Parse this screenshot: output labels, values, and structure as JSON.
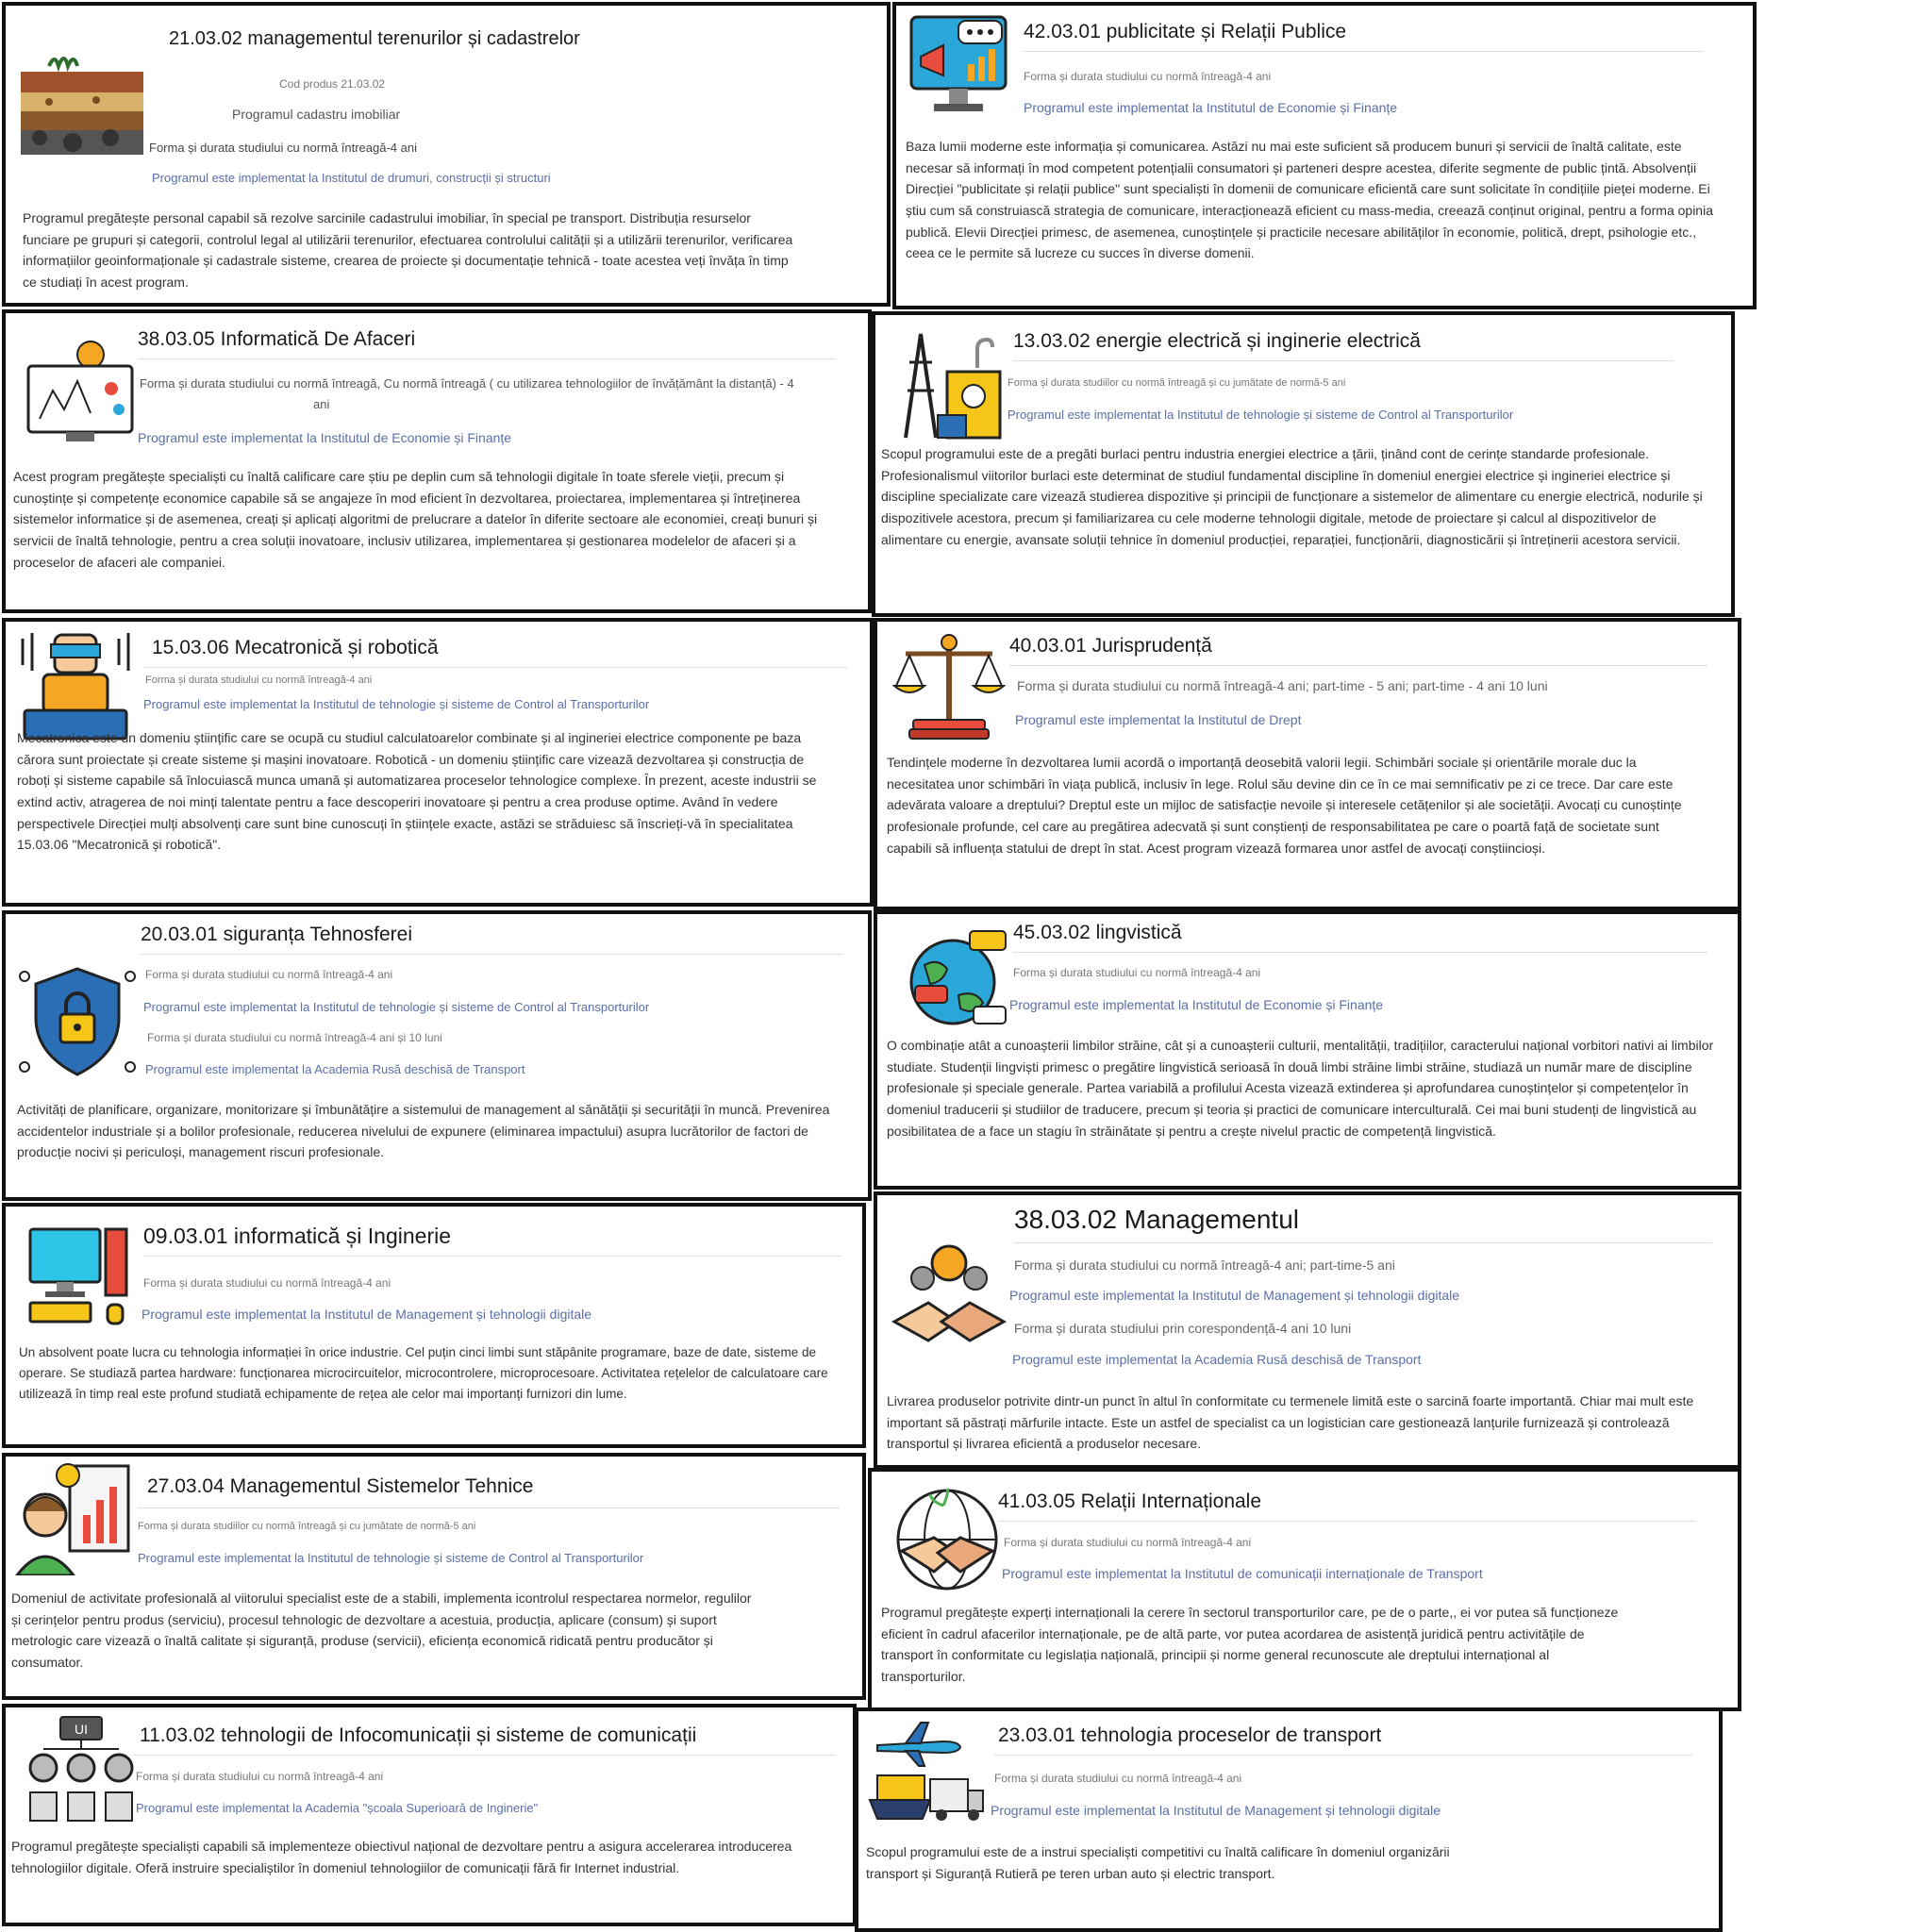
{
  "programs": [
    {
      "title": "21.03.02 managementul terenurilor și cadastrelor",
      "icon": "soil-layers-icon",
      "code": "Cod produs 21.03.02",
      "subtitle": "Programul cadastru imobiliar",
      "forma1": "Forma și durata studiului cu normă întreagă-4 ani",
      "impl1": "Programul este implementat la Institutul de drumuri, construcții și structuri",
      "desc": "Programul pregătește personal capabil să rezolve sarcinile cadastrului imobiliar, în special pe transport. Distribuția resurselor funciare pe grupuri și categorii, controlul legal al utilizării terenurilor, efectuarea controlului calității și a utilizării terenurilor, verificarea informațiilor geoinformaționale și cadastrale sisteme, crearea de proiecte și documentație tehnică - toate acestea veți învăța în timp ce studiați în acest program."
    },
    {
      "title": "42.03.01 publicitate și Relații Publice",
      "icon": "megaphone-monitor-icon",
      "forma1": "Forma și durata studiului cu normă întreagă-4 ani",
      "impl1": "Programul este implementat la Institutul de Economie și Finanțe",
      "desc": "Baza lumii moderne este informația și comunicarea. Astăzi nu mai este suficient să producem bunuri și servicii de înaltă calitate, este necesar să informați în mod competent potențialii consumatori și parteneri despre acestea, diferite segmente de public țintă. Absolvenții Direcției \"publicitate și relații publice\" sunt specialiști în domenii de comunicare eficientă care sunt solicitate în condițiile pieței moderne. Ei știu cum să construiască strategia de comunicare, interacționează eficient cu mass-media, creează conținut original, pentru a forma opinia publică. Elevii Direcției primesc, de asemenea, cunoștințele și practicile necesare abilităților în economie, politică, drept, psihologie etc., ceea ce le permite să lucreze cu succes în diverse domenii."
    },
    {
      "title": "38.03.05 Informatică De Afaceri",
      "icon": "analytics-monitor-icon",
      "forma1": "Forma și durata studiului cu normă întreagă, Cu normă întreagă ( cu utilizarea tehnologiilor de învățământ la distanță) - 4",
      "forma1b": "ani",
      "impl1": "Programul este implementat la Institutul de Economie și Finanțe",
      "desc": "Acest program pregătește specialiști cu înaltă calificare care știu pe deplin cum să tehnologii digitale în toate sferele vieții, precum și cunoștințe și competențe economice capabile să se angajeze în mod eficient în dezvoltarea, proiectarea, implementarea și întreținerea sistemelor informatice și de asemenea, creați și aplicați algoritmi de prelucrare a datelor în diferite sectoare ale economiei, creați bunuri și servicii de înaltă tehnologie, pentru a crea soluții inovatoare, inclusiv utilizarea, implementarea și gestionarea modelelor de afaceri și a proceselor de afaceri ale companiei."
    },
    {
      "title": "13.03.02 energie electrică și inginerie electrică",
      "icon": "power-plant-icon",
      "forma1": "Forma și durata studiilor cu normă întreagă și cu jumătate de normă-5 ani",
      "impl1": "Programul este implementat la Institutul de tehnologie și sisteme de Control al Transporturilor",
      "desc": "Scopul programului este de a pregăti burlaci pentru industria energiei electrice a țării, ținând cont de cerințe standarde profesionale. Profesionalismul viitorilor burlaci este determinat de studiul fundamental discipline în domeniul energiei electrice și ingineriei electrice și discipline specializate care vizează studierea dispozitive și principii de funcționare a sistemelor de alimentare cu energie electrică, nodurile și dispozitivele acestora, precum și familiarizarea cu cele moderne tehnologii digitale, metode de proiectare și calcul al dispozitivelor de alimentare cu energie, avansate soluții tehnice în domeniul producției, reparației, funcționării, diagnosticării și întreținerii acestora servicii."
    },
    {
      "title": "15.03.06 Mecatronică și robotică",
      "icon": "robot-operator-icon",
      "forma1": "Forma și durata studiului cu normă întreagă-4 ani",
      "impl1": "Programul este implementat la Institutul de tehnologie și sisteme de Control al Transporturilor",
      "desc": "Mecatronica este un domeniu științific care se ocupă cu studiul calculatoarelor combinate și al ingineriei electrice componente pe baza cărora sunt proiectate și create sisteme și mașini inovatoare. Robotică - un domeniu științific care vizează dezvoltarea și construcția de roboți și sisteme capabile să înlocuiască munca umană și automatizarea proceselor tehnologice complexe. În prezent, aceste industrii se extind activ, atragerea de noi minți talentate pentru a face descoperiri inovatoare și pentru a crea produse optime. Având în vedere perspectivele Direcției mulți absolvenți care sunt bine cunoscuți în științele exacte, astăzi se străduiesc să înscrieți-vă în specialitatea 15.03.06 \"Mecatronică și robotică\"."
    },
    {
      "title": "40.03.01 Jurisprudență",
      "icon": "justice-scales-icon",
      "forma1": "Forma și durata studiului cu normă întreagă-4 ani; part-time - 5 ani; part-time - 4 ani 10 luni",
      "impl1": "Programul este implementat la Institutul de Drept",
      "desc": "Tendințele moderne în dezvoltarea lumii acordă o importanță deosebită valorii legii. Schimbări sociale și orientările morale duc la necesitatea unor schimbări în viața publică, inclusiv în lege. Rolul său devine din ce în ce mai semnificativ pe zi ce trece. Dar care este adevărata valoare a dreptului? Dreptul este un mijloc de satisfacție nevoile și interesele cetățenilor și ale societății. Avocați cu cunoștințe profesionale profunde, cel care au pregătirea adecvată și sunt conștienți de responsabilitatea pe care o poartă față de societate sunt capabili să influența statului de drept în stat. Acest program vizează formarea unor astfel de avocați conștiincioși."
    },
    {
      "title": "20.03.01 siguranța Tehnosferei",
      "icon": "security-shield-lock-icon",
      "forma1": "Forma și durata studiului cu normă întreagă-4 ani",
      "impl1": "Programul este implementat la Institutul de tehnologie și sisteme de Control al Transporturilor",
      "forma2": "Forma și durata studiului cu normă întreagă-4 ani și 10 luni",
      "impl2": "Programul este implementat la Academia Rusă deschisă de Transport",
      "desc": "Activități de planificare, organizare, monitorizare și îmbunătățire a sistemului de management al sănătății și securității în muncă. Prevenirea accidentelor industriale și a bolilor profesionale, reducerea nivelului de expunere (eliminarea impactului) asupra lucrătorilor de factori de producție nocivi și periculoși, management riscuri profesionale."
    },
    {
      "title": "45.03.02 lingvistică",
      "icon": "globe-chat-icon",
      "forma1": "Forma și durata studiului cu normă întreagă-4 ani",
      "impl1": "Programul este implementat la Institutul de Economie și Finanțe",
      "desc": "O combinație atât a cunoașterii limbilor străine, cât și a cunoașterii culturii, mentalității, tradițiilor, caracterului național vorbitori nativi ai limbilor studiate. Studenții lingviști primesc o pregătire lingvistică serioasă în două limbi străine limbi străine, studiază un număr mare de discipline profesionale și speciale generale. Partea variabilă a profilului Acesta vizează extinderea și aprofundarea cunoștințelor și competențelor în domeniul traducerii și studiilor de traducere, precum și teoria și practici de comunicare interculturală. Cei mai buni studenți de lingvistică au posibilitatea de a face un stagiu în străinătate și pentru a crește nivelul practic de competență lingvistică."
    },
    {
      "title": "09.03.01 informatică și Inginerie",
      "icon": "desktop-computer-icon",
      "forma1": "Forma și durata studiului cu normă întreagă-4 ani",
      "impl1": "Programul este implementat la Institutul de Management și tehnologii digitale",
      "desc": "Un absolvent poate lucra cu tehnologia informației în orice industrie. Cel puțin cinci limbi sunt stăpânite programare, baze de date, sisteme de operare. Se studiază partea hardware: funcționarea microcircuitelor, microcontrolere, microprocesoare. Activitatea rețelelor de calculatoare care utilizează în timp real este profund studiată echipamente de rețea ale celor mai importanți furnizori din lume."
    },
    {
      "title": "38.03.02 Managementul",
      "icon": "team-handshake-icon",
      "forma1": "Forma și durata studiului cu normă întreagă-4 ani; part-time-5 ani",
      "impl1": "Programul este implementat la Institutul de Management și tehnologii digitale",
      "forma2": "Forma și durata studiului prin corespondență-4 ani 10 luni",
      "impl2": "Programul este implementat la Academia Rusă deschisă de Transport",
      "desc": "Livrarea produselor potrivite dintr-un punct în altul în conformitate cu termenele limită este o sarcină foarte importantă. Chiar mai mult este important să păstrați mărfurile intacte. Este un astfel de specialist ca un logistician care gestionează lanțurile furnizează și controlează transportul și livrarea eficientă a produselor necesare."
    },
    {
      "title": "27.03.04 Managementul Sistemelor Tehnice",
      "icon": "presenter-idea-icon",
      "forma1": "Forma și durata studiilor cu normă întreagă și cu jumătate de normă-5 ani",
      "impl1": "Programul este implementat la Institutul de tehnologie și sisteme de Control al Transporturilor",
      "desc": "Domeniul de activitate profesională al viitorului specialist este de a stabili, implementa icontrolul respectarea normelor, regulilor și cerințelor pentru produs (serviciu), procesul tehnologic de dezvoltare a acestuia, producția, aplicare (consum) și suport metrologic care vizează o înaltă calitate și siguranță, produse (servicii), eficiența economică ridicată pentru producător și consumator."
    },
    {
      "title": "41.03.05 Relații Internaționale",
      "icon": "globe-handshake-icon",
      "forma1": "Forma și durata studiului cu normă întreagă-4 ani",
      "impl1": "Programul este implementat la Institutul de comunicații internaționale de Transport",
      "desc": "Programul pregătește experți internaționali la cerere în sectorul transporturilor care, pe de o parte,, ei vor putea să funcționeze eficient în cadrul afacerilor internaționale, pe de altă parte, vor putea acordarea de asistență juridică pentru activitățile de transport în conformitate cu legislația națională, principii și norme general recunoscute ale dreptului internațional al transporturilor."
    },
    {
      "title": "11.03.02 tehnologii de Infocomunicații și sisteme de comunicații",
      "icon": "ui-gears-network-icon",
      "forma1": "Forma și durata studiului cu normă întreagă-4 ani",
      "impl1": "Programul este implementat la Academia \"școala Superioară de Inginerie\"",
      "desc": "Programul pregătește specialiști capabili să implementeze obiectivul național de dezvoltare pentru a asigura accelerarea introducerea tehnologiilor digitale. Oferă instruire specialiștilor în domeniul tehnologiilor de comunicații fără fir Internet industrial."
    },
    {
      "title": "23.03.01 tehnologia proceselor de transport",
      "icon": "transport-modes-icon",
      "forma1": "Forma și durata studiului cu normă întreagă-4 ani",
      "impl1": "Programul este implementat la Institutul de Management și tehnologii digitale",
      "desc": "Scopul programului este de a instrui specialiști competitivi cu înaltă calificare în domeniul organizării transport și Siguranță Rutieră pe teren urban auto și electric transport."
    }
  ]
}
